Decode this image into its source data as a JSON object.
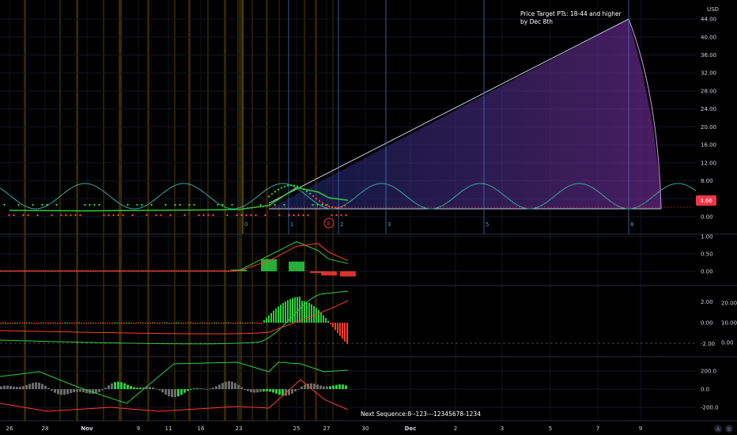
{
  "chart_data": [
    {
      "type": "line",
      "title": "",
      "currency": "USD",
      "price_axis": {
        "ticks": [
          "44.00",
          "40.00",
          "36.00",
          "32.00",
          "28.00",
          "24.00",
          "20.00",
          "16.00",
          "12.00",
          "8.00",
          "4.00",
          "0.00"
        ],
        "tick_values": [
          44,
          40,
          36,
          32,
          28,
          24,
          20,
          16,
          12,
          8,
          4,
          0
        ],
        "ylim": [
          -0.3,
          44.5
        ]
      },
      "last_price": "3.66",
      "annotation": {
        "lines": [
          "Price Target PTs: 18-44 and higher",
          "by Dec 8th"
        ]
      },
      "cycle_labels": [
        "0",
        "1",
        "2",
        "3",
        "5",
        "8"
      ],
      "earnings_marker": "E",
      "price_series": {
        "name": "",
        "x": [
          "Oct 26",
          "Nov 2",
          "Nov 9",
          "Nov 16",
          "Nov 23",
          "Nov 24",
          "Nov 25",
          "Nov 26",
          "Nov 27",
          "Nov 28"
        ],
        "values": [
          1.4,
          1.3,
          1.4,
          1.5,
          1.6,
          2.5,
          6.5,
          5.5,
          4.2,
          3.66
        ]
      },
      "projection": {
        "from": {
          "x": "Nov 24",
          "price": 3.0
        },
        "to": {
          "x": "Dec 7",
          "price": 44.0
        }
      },
      "grid": true
    },
    {
      "type": "bar",
      "title": "",
      "axis": {
        "ticks": [
          "1.00",
          "0.50",
          "0.00"
        ],
        "tick_values": [
          1.0,
          0.5,
          0.0
        ],
        "ylim": [
          -0.2,
          1.15
        ]
      },
      "histogram": {
        "x": [
          "Nov 23",
          "Nov 24",
          "Nov 25",
          "Nov 26",
          "Nov 27",
          "Nov 28"
        ],
        "values": [
          0.05,
          0.35,
          0.28,
          -0.05,
          -0.12,
          -0.15
        ]
      },
      "lines": [
        {
          "color": "#2ecc40",
          "values": [
            0.02,
            0.45,
            0.85,
            0.6,
            0.35,
            0.22
          ]
        },
        {
          "color": "#ff3b30",
          "values": [
            0.01,
            0.3,
            0.72,
            0.8,
            0.55,
            0.3
          ]
        }
      ]
    },
    {
      "type": "bar",
      "title": "",
      "axis_left": {
        "ticks": [
          "2.00",
          "0.00",
          "-2.00"
        ],
        "tick_values": [
          2.0,
          0.0,
          -2.0
        ],
        "ylim": [
          -2.5,
          2.6
        ]
      },
      "axis_right": {
        "ticks": [
          "20.00",
          "10.00",
          "0.00"
        ],
        "tick_values": [
          20,
          10,
          0
        ]
      },
      "histogram": {
        "x": [
          "Nov 23",
          "Nov 24",
          "Nov 25",
          "Nov 26",
          "Nov 27",
          "Nov 28"
        ],
        "values": [
          0.1,
          1.2,
          2.4,
          0.9,
          -0.8,
          -1.9
        ]
      }
    },
    {
      "type": "bar",
      "title": "",
      "axis": {
        "ticks": [
          "200.0",
          "0.0",
          "-200.0"
        ],
        "tick_values": [
          200,
          0,
          -200
        ],
        "ylim": [
          -260,
          320
        ]
      },
      "footer_text": "Next Sequence:8--123---12345678-1234"
    }
  ],
  "time_axis": {
    "labels": [
      "26",
      "28",
      "Nov",
      "9",
      "11",
      "16",
      "23",
      "25",
      "27",
      "30",
      "Dec",
      "2",
      "3",
      "5",
      "7",
      "9"
    ],
    "bold": [
      "Nov",
      "Dec"
    ]
  },
  "bottom_buttons": [
    "A",
    "B"
  ],
  "colors": {
    "background": "#000000",
    "bull": "#2ecc40",
    "bear": "#ff3b30",
    "price_tag": "#f23645",
    "sine_wave": "#3aa6a0",
    "projection_fill": "#6a2a8c",
    "cycle_line": "#3f6ec4"
  }
}
